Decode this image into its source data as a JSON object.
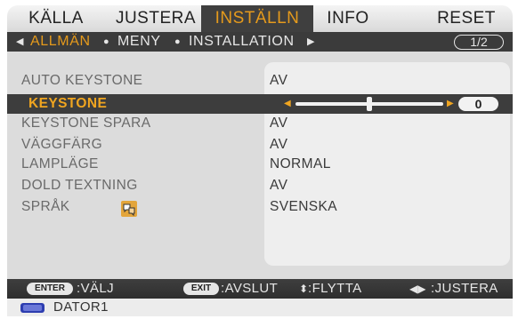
{
  "tabs": [
    {
      "label": "KÄLLA",
      "active": false
    },
    {
      "label": "JUSTERA",
      "active": false
    },
    {
      "label": "INSTÄLLN",
      "active": true
    },
    {
      "label": "INFO",
      "active": false
    },
    {
      "label": "RESET",
      "active": false
    }
  ],
  "subtabs": [
    {
      "label": "ALLMÄN",
      "active": true
    },
    {
      "label": "MENY",
      "active": false
    },
    {
      "label": "INSTALLATION",
      "active": false
    }
  ],
  "page_indicator": "1/2",
  "settings": [
    {
      "label": "AUTO KEYSTONE",
      "value": "AV"
    },
    {
      "label": "KEYSTONE",
      "value": "0",
      "selected": true,
      "slider_fraction": 0.5
    },
    {
      "label": "KEYSTONE SPARA",
      "value": "AV"
    },
    {
      "label": "VÄGGFÄRG",
      "value": "AV"
    },
    {
      "label": "LAMPLÄGE",
      "value": "NORMAL"
    },
    {
      "label": "DOLD TEXTNING",
      "value": "AV"
    },
    {
      "label": "SPRÅK",
      "value": "SVENSKA",
      "icon": "language-icon"
    }
  ],
  "footer": {
    "enter_key": "ENTER",
    "enter_text": ":VÄLJ",
    "exit_key": "EXIT",
    "exit_text": ":AVSLUT",
    "move_text": ":FLYTTA",
    "adjust_text": ":JUSTERA"
  },
  "status": {
    "source_icon": "monitor-icon",
    "source_label": "DATOR1"
  },
  "colors": {
    "accent": "#e59a1c",
    "dark_bar": "#3b3b3b",
    "panel": "#dcdcdc",
    "source_icon": "#2d3db0"
  }
}
